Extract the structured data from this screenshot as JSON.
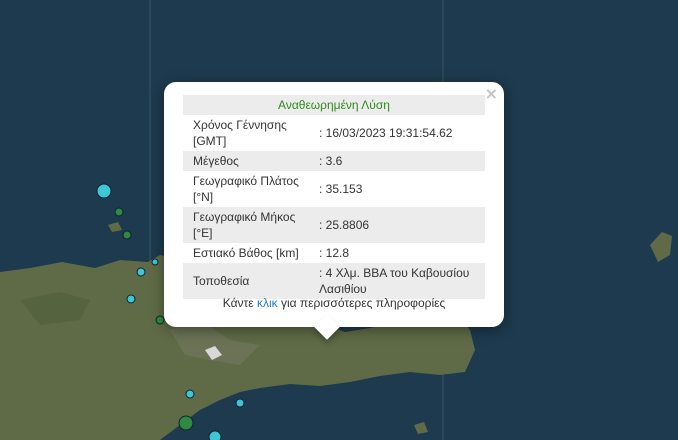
{
  "popup": {
    "close_symbol": "×",
    "title": "Αναθεωρημένη Λύση",
    "rows": [
      {
        "label": "Χρόνος Γέννησης [GMT]",
        "value": ": 16/03/2023 19:31:54.62"
      },
      {
        "label": "Μέγεθος",
        "value": ": 3.6"
      },
      {
        "label": "Γεωγραφικό Πλάτος [°N]",
        "value": ": 35.153"
      },
      {
        "label": "Γεωγραφικό Μήκος [°E]",
        "value": ": 25.8806"
      },
      {
        "label": "Εστιακό Βάθος [km]",
        "value": ": 12.8"
      },
      {
        "label": "Τοποθεσία",
        "value": ": 4 Χλμ. ΒΒΑ του Καβουσίου Λασιθίου"
      }
    ],
    "more_prefix": "Κάντε",
    "more_link": "κλικ",
    "more_suffix": "για περισσότερες πληροφορίες"
  },
  "colors": {
    "sea": "#1d3a4e",
    "land": "#5f6b46",
    "marker_cyan": "#3cc6d6",
    "marker_green": "#2d8a3e",
    "title_green": "#2e8b1e",
    "link_blue": "#1f7ec4"
  }
}
